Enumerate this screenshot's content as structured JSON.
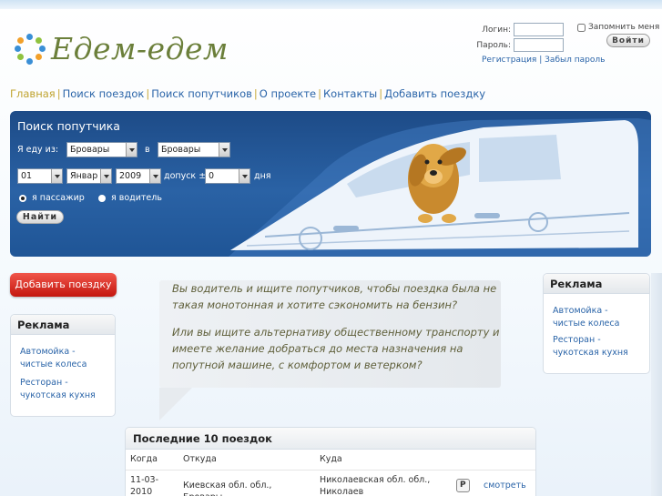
{
  "header": {
    "logo_text": "Едем-едем",
    "login_label": "Логин:",
    "password_label": "Пароль:",
    "remember_label": "Запомнить меня",
    "login_button": "Войти",
    "register_link": "Регистрация",
    "link_separator": "|",
    "forgot_link": "Забыл пароль"
  },
  "nav": {
    "items": [
      "Главная",
      "Поиск поездок",
      "Поиск попутчиков",
      "О проекте",
      "Контакты",
      "Добавить поездку"
    ],
    "separator": "|"
  },
  "search": {
    "title": "Поиск попутчика",
    "going_from_label": "Я еду из:",
    "from_value": "Бровары",
    "to_label": "в",
    "to_value": "Бровары",
    "day_value": "01",
    "month_value": "Январ",
    "year_value": "2009",
    "tolerance_label": "допуск ±",
    "tolerance_value": "0",
    "days_label": "дня",
    "role_passenger": "я пассажир",
    "role_driver": "я водитель",
    "find_button": "Найти"
  },
  "left": {
    "add_trip_button": "Добавить поездку",
    "ads_title": "Реклама",
    "ads": [
      {
        "line1": "Автомойка -",
        "line2": "чистые колеса"
      },
      {
        "line1": "Ресторан -",
        "line2": "чукотская кухня"
      }
    ]
  },
  "right": {
    "ads_title": "Реклама",
    "ads": [
      {
        "line1": "Автомойка -",
        "line2": "чистые колеса"
      },
      {
        "line1": "Ресторан -",
        "line2": "чукотская кухня"
      }
    ]
  },
  "intro": {
    "paragraph1": "Вы водитель и ищите попутчиков, чтобы поездка была не такая монотонная и хотите сэкономить на бензин?",
    "paragraph2": "Или вы ищите альтернативу общественному транспорту и имеете желание добраться до места назначения на попутной машине, с комфортом и ветерком?"
  },
  "trips": {
    "title": "Последние 10 поездок",
    "columns": [
      "Когда",
      "Откуда",
      "Куда"
    ],
    "rows": [
      {
        "when_line1": "11-03-",
        "when_line2": "2010",
        "from": "Киевская обл. обл., Бровары",
        "to_line1": "Николаевская обл. обл.,",
        "to_line2": "Николаев",
        "tag": "P",
        "action": "смотреть"
      }
    ]
  }
}
